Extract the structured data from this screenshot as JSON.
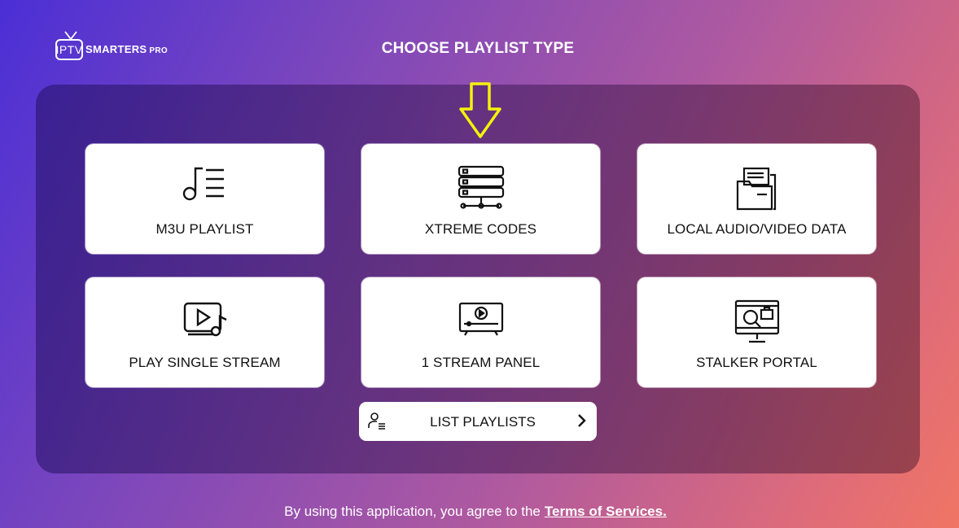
{
  "logo": {
    "iptv": "IPTV",
    "brand": "SMARTERS",
    "pro": "PRO"
  },
  "header": {
    "title": "CHOOSE PLAYLIST TYPE"
  },
  "options": [
    {
      "label": "M3U PLAYLIST",
      "icon": "music-list-icon"
    },
    {
      "label": "XTREME CODES",
      "icon": "server-icon"
    },
    {
      "label": "LOCAL AUDIO/VIDEO DATA",
      "icon": "folder-files-icon"
    },
    {
      "label": "PLAY SINGLE STREAM",
      "icon": "video-music-icon"
    },
    {
      "label": "1 STREAM PANEL",
      "icon": "tv-play-icon"
    },
    {
      "label": "STALKER PORTAL",
      "icon": "monitor-search-icon"
    }
  ],
  "list_playlists": {
    "label": "LIST PLAYLISTS",
    "icon": "user-list-icon"
  },
  "footer": {
    "text": "By using this application, you agree to the",
    "link": "Terms of Services."
  },
  "colors": {
    "arrow": "#f4f20a",
    "card_bg": "#ffffff",
    "text_dark": "#111111"
  }
}
